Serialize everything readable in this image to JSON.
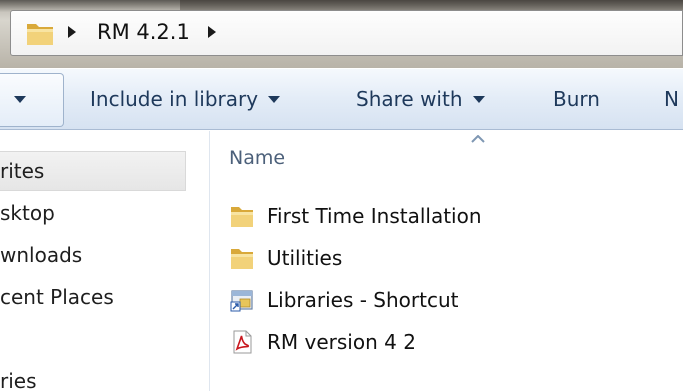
{
  "address_bar": {
    "path_segments": [
      "RM 4.2.1"
    ],
    "icons": [
      "folder-icon",
      "breadcrumb-arrow-icon"
    ]
  },
  "toolbar": {
    "items": [
      {
        "label": "Include in library",
        "has_dropdown": true
      },
      {
        "label": "Share with",
        "has_dropdown": true
      },
      {
        "label": "Burn",
        "has_dropdown": false
      },
      {
        "label": "N",
        "has_dropdown": false
      }
    ]
  },
  "nav_pane": {
    "items": [
      {
        "label": "rites",
        "selected": true
      },
      {
        "label": "sktop",
        "selected": false
      },
      {
        "label": "wnloads",
        "selected": false
      },
      {
        "label": "cent Places",
        "selected": false
      },
      {
        "label": "ries",
        "selected": false
      }
    ]
  },
  "content": {
    "column_header": "Name",
    "files": [
      {
        "name": "First Time Installation",
        "icon": "folder-icon"
      },
      {
        "name": "Utilities",
        "icon": "folder-icon"
      },
      {
        "name": "Libraries - Shortcut",
        "icon": "shortcut-icon"
      },
      {
        "name": "RM version 4 2",
        "icon": "pdf-icon"
      }
    ]
  },
  "colors": {
    "toolbar_text": "#1e395b",
    "header_text": "#4c607a",
    "folder_yellow": "#e8c55a",
    "pdf_red": "#c8171e"
  }
}
